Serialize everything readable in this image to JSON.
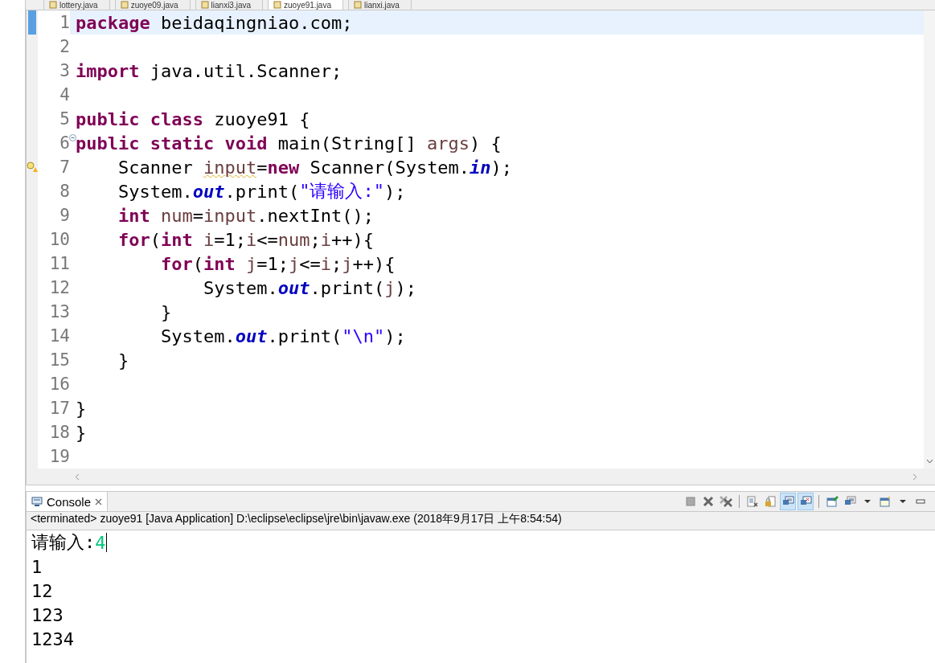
{
  "editor_tabs": [
    {
      "label": "lottery.java",
      "selected": false
    },
    {
      "label": "zuoye09.java",
      "selected": false
    },
    {
      "label": "lianxi3.java",
      "selected": false
    },
    {
      "label": "zuoye91.java",
      "selected": true
    },
    {
      "label": "lianxi.java",
      "selected": false
    }
  ],
  "code_lines": [
    {
      "number": "1",
      "current": true,
      "foldable": false,
      "warning": false,
      "tokens": [
        {
          "text": "package",
          "kind": "kw"
        },
        {
          "text": " beidaqingniao.com;",
          "kind": "plain"
        }
      ]
    },
    {
      "number": "2",
      "current": false,
      "foldable": false,
      "warning": false
    },
    {
      "number": "3",
      "current": false,
      "foldable": false,
      "warning": false,
      "tokens": [
        {
          "text": "import",
          "kind": "kw"
        },
        {
          "text": " java.util.Scanner;",
          "kind": "plain"
        }
      ]
    },
    {
      "number": "4",
      "current": false,
      "foldable": false,
      "warning": false
    },
    {
      "number": "5",
      "current": false,
      "foldable": false,
      "warning": false,
      "tokens": [
        {
          "text": "public class",
          "kind": "kw"
        },
        {
          "text": " zuoye91 {",
          "kind": "plain"
        }
      ]
    },
    {
      "number": "6",
      "current": false,
      "foldable": true,
      "warning": false,
      "tokens": [
        {
          "text": "public static void",
          "kind": "kw"
        },
        {
          "text": " main(String[] ",
          "kind": "plain"
        },
        {
          "text": "args",
          "kind": "local"
        },
        {
          "text": ") {",
          "kind": "plain"
        }
      ]
    },
    {
      "number": "7",
      "current": false,
      "foldable": false,
      "warning": true,
      "tokens": [
        {
          "text": "    Scanner ",
          "kind": "plain"
        },
        {
          "text": "input",
          "kind": "warn"
        },
        {
          "text": "=",
          "kind": "plain"
        },
        {
          "text": "new",
          "kind": "kw"
        },
        {
          "text": " Scanner(System.",
          "kind": "plain"
        },
        {
          "text": "in",
          "kind": "field"
        },
        {
          "text": ");",
          "kind": "plain"
        }
      ]
    },
    {
      "number": "8",
      "current": false,
      "foldable": false,
      "warning": false,
      "tokens": [
        {
          "text": "    System.",
          "kind": "plain"
        },
        {
          "text": "out",
          "kind": "field"
        },
        {
          "text": ".print(",
          "kind": "plain"
        },
        {
          "text": "\"请输入:\"",
          "kind": "str"
        },
        {
          "text": ");",
          "kind": "plain"
        }
      ]
    },
    {
      "number": "9",
      "current": false,
      "foldable": false,
      "warning": false,
      "tokens": [
        {
          "text": "    int",
          "kind": "kw"
        },
        {
          "text": " num",
          "kind": "local"
        },
        {
          "text": "=",
          "kind": "plain"
        },
        {
          "text": "input",
          "kind": "local"
        },
        {
          "text": ".nextInt();",
          "kind": "plain"
        }
      ]
    },
    {
      "number": "10",
      "current": false,
      "foldable": false,
      "warning": false,
      "tokens": [
        {
          "text": "    for",
          "kind": "kw"
        },
        {
          "text": "(",
          "kind": "plain"
        },
        {
          "text": "int",
          "kind": "kw"
        },
        {
          "text": " i",
          "kind": "local"
        },
        {
          "text": "=1;",
          "kind": "plain"
        },
        {
          "text": "i",
          "kind": "local"
        },
        {
          "text": "<=",
          "kind": "plain"
        },
        {
          "text": "num",
          "kind": "local"
        },
        {
          "text": ";",
          "kind": "plain"
        },
        {
          "text": "i",
          "kind": "local"
        },
        {
          "text": "++){",
          "kind": "plain"
        }
      ]
    },
    {
      "number": "11",
      "current": false,
      "foldable": false,
      "warning": false,
      "tokens": [
        {
          "text": "        for",
          "kind": "kw"
        },
        {
          "text": "(",
          "kind": "plain"
        },
        {
          "text": "int",
          "kind": "kw"
        },
        {
          "text": " j",
          "kind": "local"
        },
        {
          "text": "=1;",
          "kind": "plain"
        },
        {
          "text": "j",
          "kind": "local"
        },
        {
          "text": "<=",
          "kind": "plain"
        },
        {
          "text": "i",
          "kind": "local"
        },
        {
          "text": ";",
          "kind": "plain"
        },
        {
          "text": "j",
          "kind": "local"
        },
        {
          "text": "++){",
          "kind": "plain"
        }
      ]
    },
    {
      "number": "12",
      "current": false,
      "foldable": false,
      "warning": false,
      "tokens": [
        {
          "text": "            System.",
          "kind": "plain"
        },
        {
          "text": "out",
          "kind": "field"
        },
        {
          "text": ".print(",
          "kind": "plain"
        },
        {
          "text": "j",
          "kind": "local"
        },
        {
          "text": ");",
          "kind": "plain"
        }
      ]
    },
    {
      "number": "13",
      "current": false,
      "foldable": false,
      "warning": false,
      "tokens": [
        {
          "text": "        }",
          "kind": "plain"
        }
      ]
    },
    {
      "number": "14",
      "current": false,
      "foldable": false,
      "warning": false,
      "tokens": [
        {
          "text": "        System.",
          "kind": "plain"
        },
        {
          "text": "out",
          "kind": "field"
        },
        {
          "text": ".print(",
          "kind": "plain"
        },
        {
          "text": "\"\\n\"",
          "kind": "str"
        },
        {
          "text": ");",
          "kind": "plain"
        }
      ]
    },
    {
      "number": "15",
      "current": false,
      "foldable": false,
      "warning": false,
      "tokens": [
        {
          "text": "    }",
          "kind": "plain"
        }
      ]
    },
    {
      "number": "16",
      "current": false,
      "foldable": false,
      "warning": false
    },
    {
      "number": "17",
      "current": false,
      "foldable": false,
      "warning": false,
      "tokens": [
        {
          "text": "}",
          "kind": "plain"
        }
      ]
    },
    {
      "number": "18",
      "current": false,
      "foldable": false,
      "warning": false,
      "tokens": [
        {
          "text": "}",
          "kind": "plain"
        }
      ]
    },
    {
      "number": "19",
      "current": false,
      "foldable": false,
      "warning": false
    }
  ],
  "console": {
    "title": "Console",
    "toolbar": [
      {
        "kind": "terminate",
        "selected": false
      },
      {
        "kind": "remove",
        "selected": false
      },
      {
        "kind": "remove-all",
        "selected": false
      },
      {
        "kind": "separator"
      },
      {
        "kind": "clear",
        "selected": false
      },
      {
        "kind": "scroll-lock",
        "selected": false
      },
      {
        "kind": "stdout",
        "selected": true
      },
      {
        "kind": "stderr",
        "selected": true
      },
      {
        "kind": "separator"
      },
      {
        "kind": "pin",
        "selected": false
      },
      {
        "kind": "display",
        "selected": false
      },
      {
        "kind": "menu",
        "selected": false
      },
      {
        "kind": "open",
        "selected": false
      },
      {
        "kind": "menu",
        "selected": false
      },
      {
        "kind": "minimize",
        "selected": false
      }
    ],
    "description": "<terminated> zuoye91 [Java Application] D:\\eclipse\\eclipse\\jre\\bin\\javaw.exe (2018年9月17日 上午8:54:54)",
    "output": [
      {
        "segments": [
          {
            "text": "请输入:",
            "kind": "out"
          },
          {
            "text": "4",
            "kind": "in"
          }
        ]
      },
      {
        "segments": [
          {
            "text": "1",
            "kind": "out"
          }
        ]
      },
      {
        "segments": [
          {
            "text": "12",
            "kind": "out"
          }
        ]
      },
      {
        "segments": [
          {
            "text": "123",
            "kind": "out"
          }
        ]
      },
      {
        "segments": [
          {
            "text": "1234",
            "kind": "out"
          }
        ]
      }
    ]
  }
}
